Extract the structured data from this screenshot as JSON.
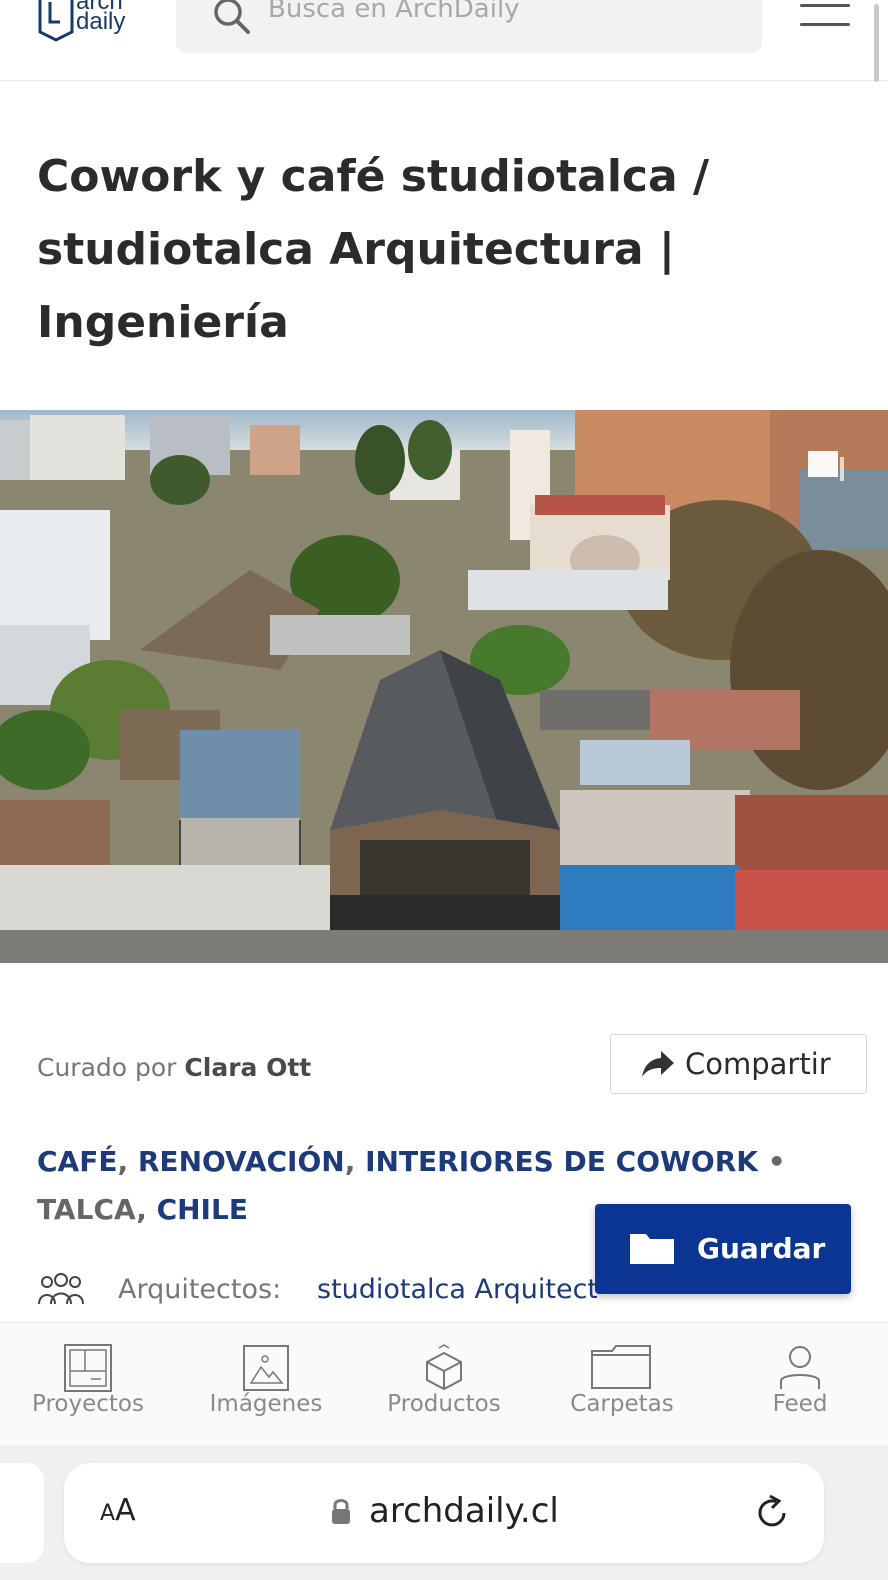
{
  "header": {
    "logo_text_top": "arch",
    "logo_text_bottom": "daily",
    "search_placeholder": "Busca en ArchDaily",
    "search_icon": "search-icon",
    "menu_icon": "hamburger-menu-icon"
  },
  "article": {
    "title": "Cowork y café studiotalca / studiotalca Arquitectura | Ingeniería",
    "hero_image_icon": "expand-icon",
    "curated_prefix": "Curado por",
    "curator": "Clara Ott",
    "share_label": "Compartir",
    "tags": {
      "tag1": "CAFÉ",
      "tag2": "RENOVACIÓN",
      "tag3": "INTERIORES DE COWORK",
      "separator": "•",
      "city": "TALCA",
      "country": "CHILE"
    },
    "save_label": "Guardar",
    "architects_label": "Arquitectos:",
    "architects_value": "studiotalca Arquitectura |"
  },
  "bottom_nav": {
    "items": [
      {
        "label": "Proyectos",
        "icon": "projects-icon"
      },
      {
        "label": "Imágenes",
        "icon": "images-icon"
      },
      {
        "label": "Productos",
        "icon": "products-icon"
      },
      {
        "label": "Carpetas",
        "icon": "folder-icon"
      },
      {
        "label": "Feed",
        "icon": "user-icon"
      }
    ]
  },
  "browser": {
    "text_size_label_small": "A",
    "text_size_label_large": "A",
    "url": "archdaily.cl",
    "lock_icon": "lock-icon",
    "reload_icon": "reload-icon"
  },
  "colors": {
    "accent": "#0b3593",
    "link": "#1d3a7a",
    "title": "#2b2b2b"
  }
}
